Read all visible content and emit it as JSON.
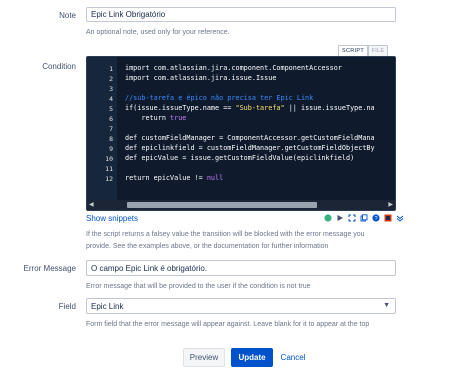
{
  "note": {
    "label": "Note",
    "value": "Epic Link Obrigatório",
    "help": "An optional note, used only for your reference."
  },
  "condition": {
    "label": "Condition",
    "tabs": [
      "SCRIPT",
      "FILE"
    ],
    "line_numbers": [
      "1",
      "2",
      "3",
      "4",
      "5",
      "6",
      "7",
      "8",
      "9",
      "10",
      "11",
      "12"
    ],
    "code": {
      "l1": "import com.atlassian.jira.component.ComponentAccessor",
      "l2": "import com.atlassian.jira.issue.Issue",
      "l4": "//sub-tarefa e épico não precisa ter Epic Link",
      "l5a": "if(issue.issueType.name == ",
      "l5b": "\"Sub-tarefa\"",
      "l5c": " || issue.issueType.na",
      "l6a": "    return ",
      "l6b": "true",
      "l8": "def customFieldManager = ComponentAccessor.getCustomFieldMana",
      "l9": "def epiclinkfield = customFieldManager.getCustomFieldObjectBy",
      "l10": "def epicValue = issue.getCustomFieldValue(epiclinkfield)",
      "l12a": "return epicValue != ",
      "l12b": "null"
    },
    "show_snippets": "Show snippets",
    "help_line1": "If the script returns a falsey value the transition will be blocked with the error message you",
    "help_line2": "provide. See the examples above, or the documentation for further information"
  },
  "error_message": {
    "label": "Error Message",
    "value": "O campo Epic Link é obrigatório.",
    "help": "Error message that will be provided to the user if the condition is not true"
  },
  "field": {
    "label": "Field",
    "value": "Epic Link",
    "help": "Form field that the error message will appear against. Leave blank for it to appear at the top"
  },
  "buttons": {
    "preview": "Preview",
    "update": "Update",
    "cancel": "Cancel"
  },
  "icons": [
    "check-circle-icon",
    "play-icon",
    "expand-icon",
    "copy-icon",
    "help-icon",
    "plugin-icon",
    "chevron-down-icon"
  ],
  "colors": {
    "accent": "#0052cc",
    "editor_bg": "#0f1b2d",
    "comment": "#3d8bff",
    "string": "#ffe26b",
    "literal": "#c77dff"
  }
}
